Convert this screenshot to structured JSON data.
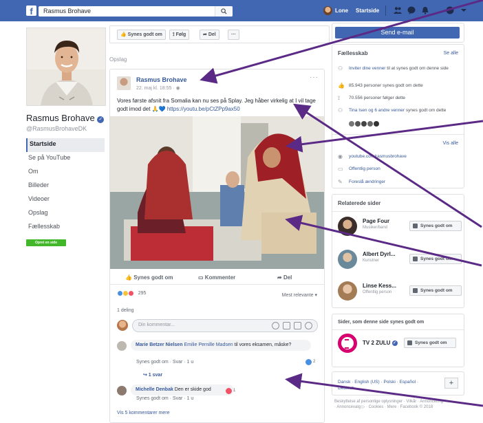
{
  "topbar": {
    "search_value": "Rasmus Brohave",
    "user_name": "Lone",
    "home_label": "Startside"
  },
  "profile": {
    "name": "Rasmus Brohave",
    "handle": "@RasmusBrohaveDK",
    "nav": [
      "Startside",
      "Se på YouTube",
      "Om",
      "Billeder",
      "Videoer",
      "Opslag",
      "Fællesskab"
    ],
    "create_page_label": "Opret en side"
  },
  "actionbar": {
    "like_label": "Synes godt om",
    "follow_label": "Følg",
    "share_label": "Del",
    "more_label": "···"
  },
  "section_label": "Opslag",
  "post": {
    "author": "Rasmus Brohave",
    "date": "22. maj kl. 18:55 · ",
    "text_main": "Vores første afsnit fra Somalia kan nu ses på Splay. Jeg håber virkelig at I vil tage godt imod det 🙏💙 ",
    "text_link": "https://youtu.be/pCtZPp9ax50",
    "actions": {
      "like": "Synes godt om",
      "comment": "Kommenter",
      "share": "Del"
    },
    "reaction_count": "295",
    "sort_label": "Mest relevante ▾",
    "shares_label": "1 deling",
    "comment_placeholder": "Din kommentar...",
    "comments": [
      {
        "name": "Marie Betzer Nielsen",
        "mention": "Emilie Pernille Madsen",
        "text": " til vores eksamen, måske?",
        "meta": "Synes godt om · Svar · 1 u",
        "reactions": "2",
        "replies": "↪ 1 svar"
      },
      {
        "name": "Michelle Denbak",
        "text": " Den er skide god",
        "meta": "Synes godt om · Svar · 1 u",
        "reactions": "1"
      }
    ],
    "more_comments": "Vis 5 kommentarer mere"
  },
  "right": {
    "send_email": "Send e-mail",
    "community": {
      "title": "Fællesskab",
      "see_all": "Se alle",
      "rows": [
        {
          "pre": "Inviter dine venner",
          "post": " til at synes godt om denne side",
          "icon": "invite-icon"
        },
        {
          "pre": "",
          "post": "85.943 personer synes godt om dette",
          "icon": "like-icon"
        },
        {
          "pre": "",
          "post": "70.556 personer følger dette",
          "icon": "rss-icon"
        },
        {
          "pre": "Tina Isen og 6 andre venner",
          "post": " synes godt om dette",
          "icon": "friends-icon"
        }
      ]
    },
    "about": {
      "see_all": "Vis alle",
      "rows": [
        {
          "text": "youtube.com/rasmusbrohave",
          "icon": "globe-icon"
        },
        {
          "text": "Offentlig person",
          "icon": "page-icon"
        },
        {
          "text": "Foreslå ændringer",
          "icon": "pencil-icon"
        }
      ]
    },
    "related": {
      "title": "Relaterede sider",
      "items": [
        {
          "name": "Page Four",
          "sub": "Musiker/band",
          "button": "Synes godt om"
        },
        {
          "name": "Albert Dyrl...",
          "sub": "Kunstner",
          "button": "Synes godt om"
        },
        {
          "name": "Linse Kess...",
          "sub": "Offentlig person",
          "button": "Synes godt om"
        }
      ]
    },
    "liked_pages": {
      "title": "Sider, som denne side synes godt om",
      "items": [
        {
          "name": "TV 2 ZULU",
          "button": "Synes godt om"
        }
      ]
    },
    "languages": "Dansk · English (US) · Polski · Español · Deutsch",
    "footer": "Beskyttelse af personlige oplysninger · Vilkår · Annoncering · Annoncevalg ▷ · Cookies · Mere · Facebook © 2018"
  },
  "colors": {
    "facebook_blue": "#4267b2",
    "link_blue": "#365899",
    "annotation_arrow": "#5b2a86",
    "create_green": "#42b72a",
    "tv2_magenta": "#d6006f"
  }
}
